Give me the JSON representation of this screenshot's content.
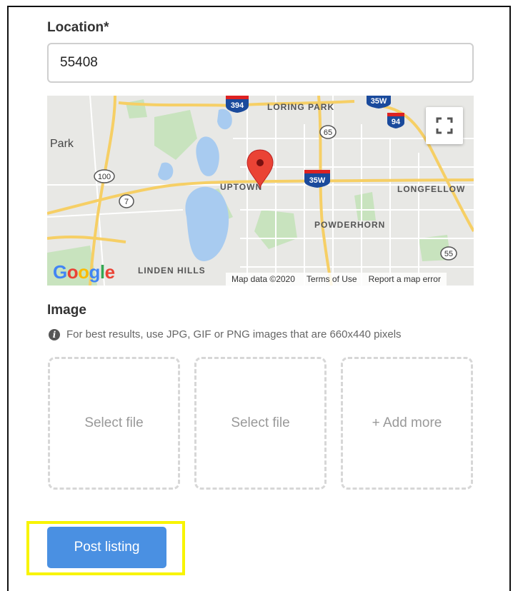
{
  "location": {
    "label": "Location*",
    "value": "55408"
  },
  "map": {
    "places": {
      "park": "Park",
      "loring_park": "LORING PARK",
      "uptown": "UPTOWN",
      "longfellow": "LONGFELLOW",
      "powderhorn": "POWDERHORN",
      "linden_hills": "LINDEN HILLS"
    },
    "shields": {
      "i394": "394",
      "i35w_top": "35W",
      "i94": "94",
      "r65": "65",
      "r100": "100",
      "r7": "7",
      "i35w_mid": "35W",
      "r55": "55"
    },
    "footer": {
      "data": "Map data ©2020",
      "terms": "Terms of Use",
      "report": "Report a map error"
    },
    "logo_letters": [
      "G",
      "o",
      "o",
      "g",
      "l",
      "e"
    ],
    "logo_colors": [
      "#4285F4",
      "#EA4335",
      "#FBBC05",
      "#4285F4",
      "#34A853",
      "#EA4335"
    ],
    "pin_color": "#EA4335"
  },
  "image": {
    "label": "Image",
    "hint": "For best results, use JPG, GIF or PNG images that are 660x440 pixels",
    "boxes": [
      "Select file",
      "Select file",
      "+ Add more"
    ]
  },
  "submit": {
    "label": "Post listing",
    "color": "#4a90e2",
    "highlight_color": "#f8f400"
  }
}
